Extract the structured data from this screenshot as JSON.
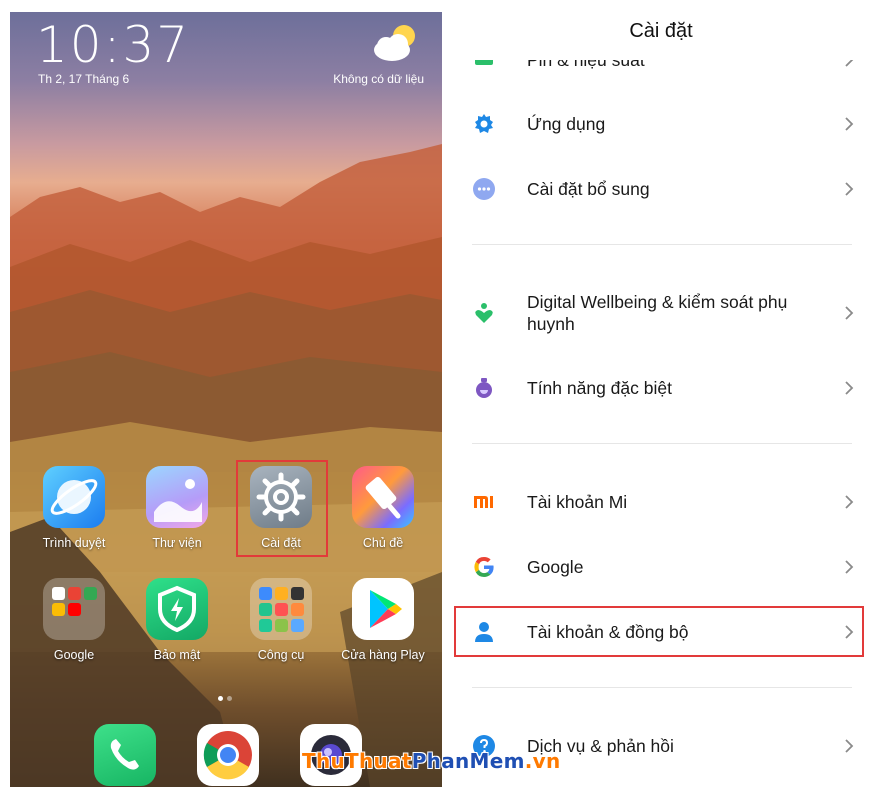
{
  "home": {
    "time": "10:37",
    "date": "Th 2, 17 Tháng 6",
    "weather": "Không có dữ liệu",
    "apps": [
      {
        "label": "Trình duyệt",
        "icon": "browser-icon"
      },
      {
        "label": "Thư viện",
        "icon": "gallery-icon"
      },
      {
        "label": "Cài đặt",
        "icon": "settings-gear-icon"
      },
      {
        "label": "Chủ đề",
        "icon": "themes-icon"
      },
      {
        "label": "Google",
        "icon": "google-folder-icon"
      },
      {
        "label": "Bảo mật",
        "icon": "security-shield-icon"
      },
      {
        "label": "Công cụ",
        "icon": "tools-folder-icon"
      },
      {
        "label": "Cửa hàng Play",
        "icon": "play-store-icon"
      }
    ],
    "dock": [
      "phone-icon",
      "chrome-icon",
      "camera-icon"
    ]
  },
  "settings": {
    "title": "Cài đặt",
    "items": [
      {
        "label": "Pin & hiệu suất"
      },
      {
        "label": "Ứng dụng"
      },
      {
        "label": "Cài đặt bổ sung"
      },
      {
        "label": "Digital Wellbeing & kiểm soát phụ huynh"
      },
      {
        "label": "Tính năng đặc biệt"
      },
      {
        "label": "Tài khoản Mi"
      },
      {
        "label": "Google"
      },
      {
        "label": "Tài khoản & đồng bộ"
      },
      {
        "label": "Dịch vụ & phản hồi"
      }
    ]
  },
  "colors": {
    "highlight": "#e23a3a",
    "accent_blue": "#1e88e5",
    "wellbeing_green": "#2bbf6a",
    "special_purple": "#7e57c2",
    "mi_orange": "#ff6900"
  },
  "watermark": {
    "part1": "ThuThuat",
    "part2": "PhanMem",
    "part3": ".vn"
  }
}
